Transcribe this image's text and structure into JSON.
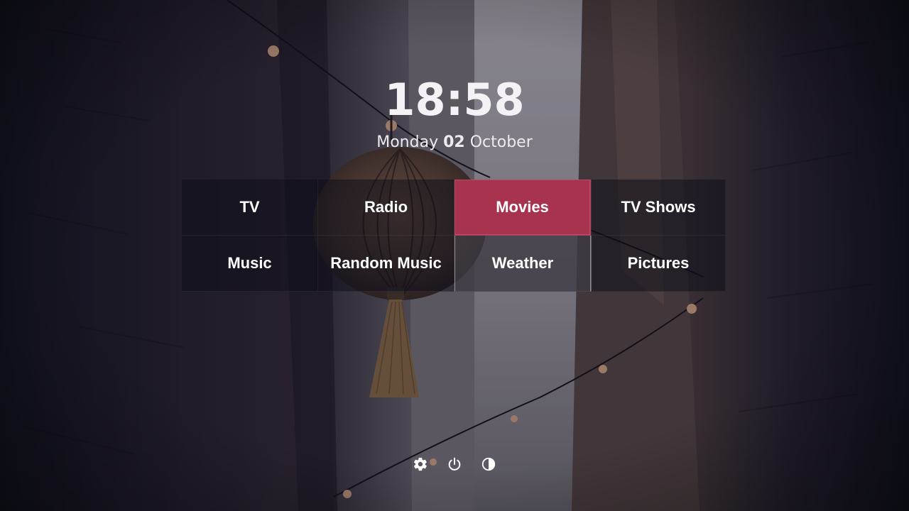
{
  "clock": {
    "time": "18:58",
    "weekday": "Monday",
    "day": "02",
    "month": "October"
  },
  "menu": {
    "items": [
      {
        "label": "TV"
      },
      {
        "label": "Radio"
      },
      {
        "label": "Movies",
        "selected": true
      },
      {
        "label": "TV Shows"
      },
      {
        "label": "Music"
      },
      {
        "label": "Random Music"
      },
      {
        "label": "Weather"
      },
      {
        "label": "Pictures"
      }
    ]
  },
  "controls": [
    {
      "icon": "gear-icon"
    },
    {
      "icon": "power-icon"
    },
    {
      "icon": "theme-contrast-icon"
    }
  ],
  "colors": {
    "accent": "#a8334f",
    "text": "#ffffff",
    "tile_background": "#0e0e18"
  }
}
